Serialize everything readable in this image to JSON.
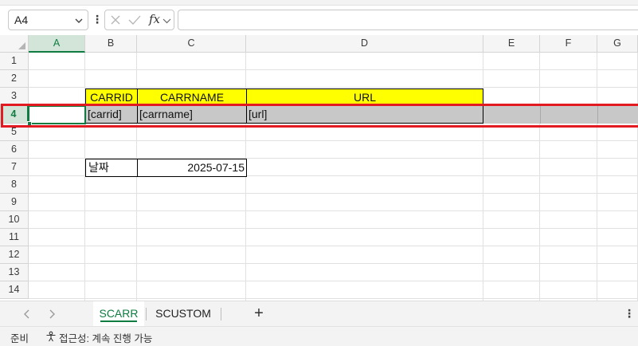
{
  "formula_bar": {
    "name_box": "A4",
    "more_glyph": "⋮",
    "fx_label": "fx",
    "formula": ""
  },
  "columns": [
    "A",
    "B",
    "C",
    "D",
    "E",
    "F",
    "G"
  ],
  "rows": [
    "1",
    "2",
    "3",
    "4",
    "5",
    "6",
    "7",
    "8",
    "9",
    "10",
    "11",
    "12",
    "13",
    "14"
  ],
  "active_cell": "A4",
  "cells": {
    "B3": "CARRID",
    "C3": "CARRNAME",
    "D3": "URL",
    "B4": "[carrid]",
    "C4": "[carrname]",
    "D4": "[url]",
    "B7": "날짜",
    "C7": "2025-07-15"
  },
  "sheets": {
    "active": "SCARR",
    "tabs": [
      "SCARR",
      "SCUSTOM"
    ],
    "add_glyph": "+",
    "more_glyph": "⋮"
  },
  "status": {
    "ready": "준비",
    "accessibility": "접근성: 계속 진행 가능"
  },
  "colors": {
    "accent": "#107c41",
    "header_fill": "#ffff00",
    "row_fill": "#c8c8c8",
    "highlight": "#e21b23"
  },
  "icons": [
    "chevron-down-icon",
    "cancel-x-icon",
    "checkmark-icon",
    "chevron-left-icon",
    "chevron-right-icon",
    "accessibility-icon"
  ]
}
